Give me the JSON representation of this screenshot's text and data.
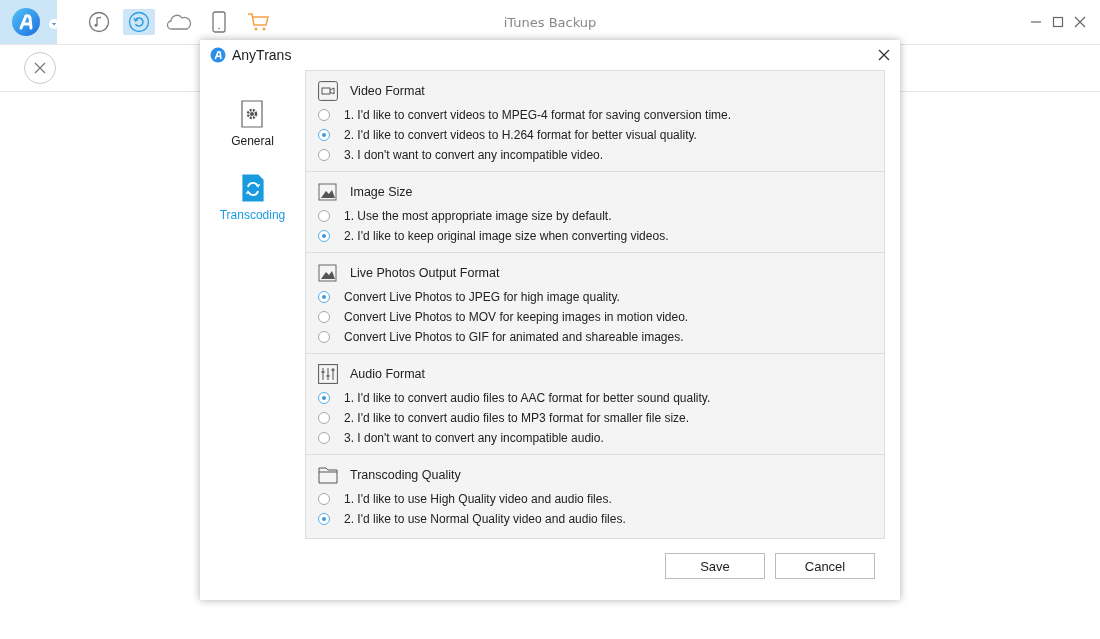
{
  "window": {
    "title": "iTunes Backup"
  },
  "toolbar": [
    {
      "kind": "music",
      "selected": false
    },
    {
      "kind": "backup",
      "selected": true
    },
    {
      "kind": "cloud",
      "selected": false
    },
    {
      "kind": "phone",
      "selected": false
    },
    {
      "kind": "cart",
      "selected": false
    }
  ],
  "dialog": {
    "title": "AnyTrans",
    "sidebar": [
      {
        "kind": "general",
        "label": "General",
        "selected": false
      },
      {
        "kind": "transcoding",
        "label": "Transcoding",
        "selected": true
      }
    ],
    "sections": [
      {
        "kind": "video",
        "title": "Video Format",
        "options": [
          {
            "label": "1. I'd like to convert videos to MPEG-4 format for saving conversion time.",
            "selected": false
          },
          {
            "label": "2. I'd like to convert videos to H.264 format for better visual quality.",
            "selected": true
          },
          {
            "label": "3. I don't want to convert any incompatible video.",
            "selected": false
          }
        ]
      },
      {
        "kind": "image",
        "title": "Image Size",
        "options": [
          {
            "label": "1. Use the most appropriate image size by default.",
            "selected": false
          },
          {
            "label": "2. I'd like to keep original image size when converting videos.",
            "selected": true
          }
        ]
      },
      {
        "kind": "image",
        "title": "Live Photos Output Format",
        "options": [
          {
            "label": "Convert Live Photos to JPEG for high image quality.",
            "selected": true
          },
          {
            "label": "Convert Live Photos to MOV for keeping images in motion video.",
            "selected": false
          },
          {
            "label": "Convert Live Photos to GIF for animated and shareable images.",
            "selected": false
          }
        ]
      },
      {
        "kind": "audio",
        "title": "Audio Format",
        "options": [
          {
            "label": "1. I'd like to convert audio files to AAC format for better sound quality.",
            "selected": true
          },
          {
            "label": "2. I'd like to convert audio files to MP3 format for smaller file size.",
            "selected": false
          },
          {
            "label": "3. I don't want to convert any incompatible audio.",
            "selected": false
          }
        ]
      },
      {
        "kind": "folder",
        "title": "Transcoding Quality",
        "options": [
          {
            "label": "1. I'd like to use High Quality video and audio files.",
            "selected": false
          },
          {
            "label": "2. I'd like to use Normal Quality video and audio files.",
            "selected": true
          }
        ]
      }
    ],
    "buttons": [
      "Save",
      "Cancel"
    ]
  }
}
